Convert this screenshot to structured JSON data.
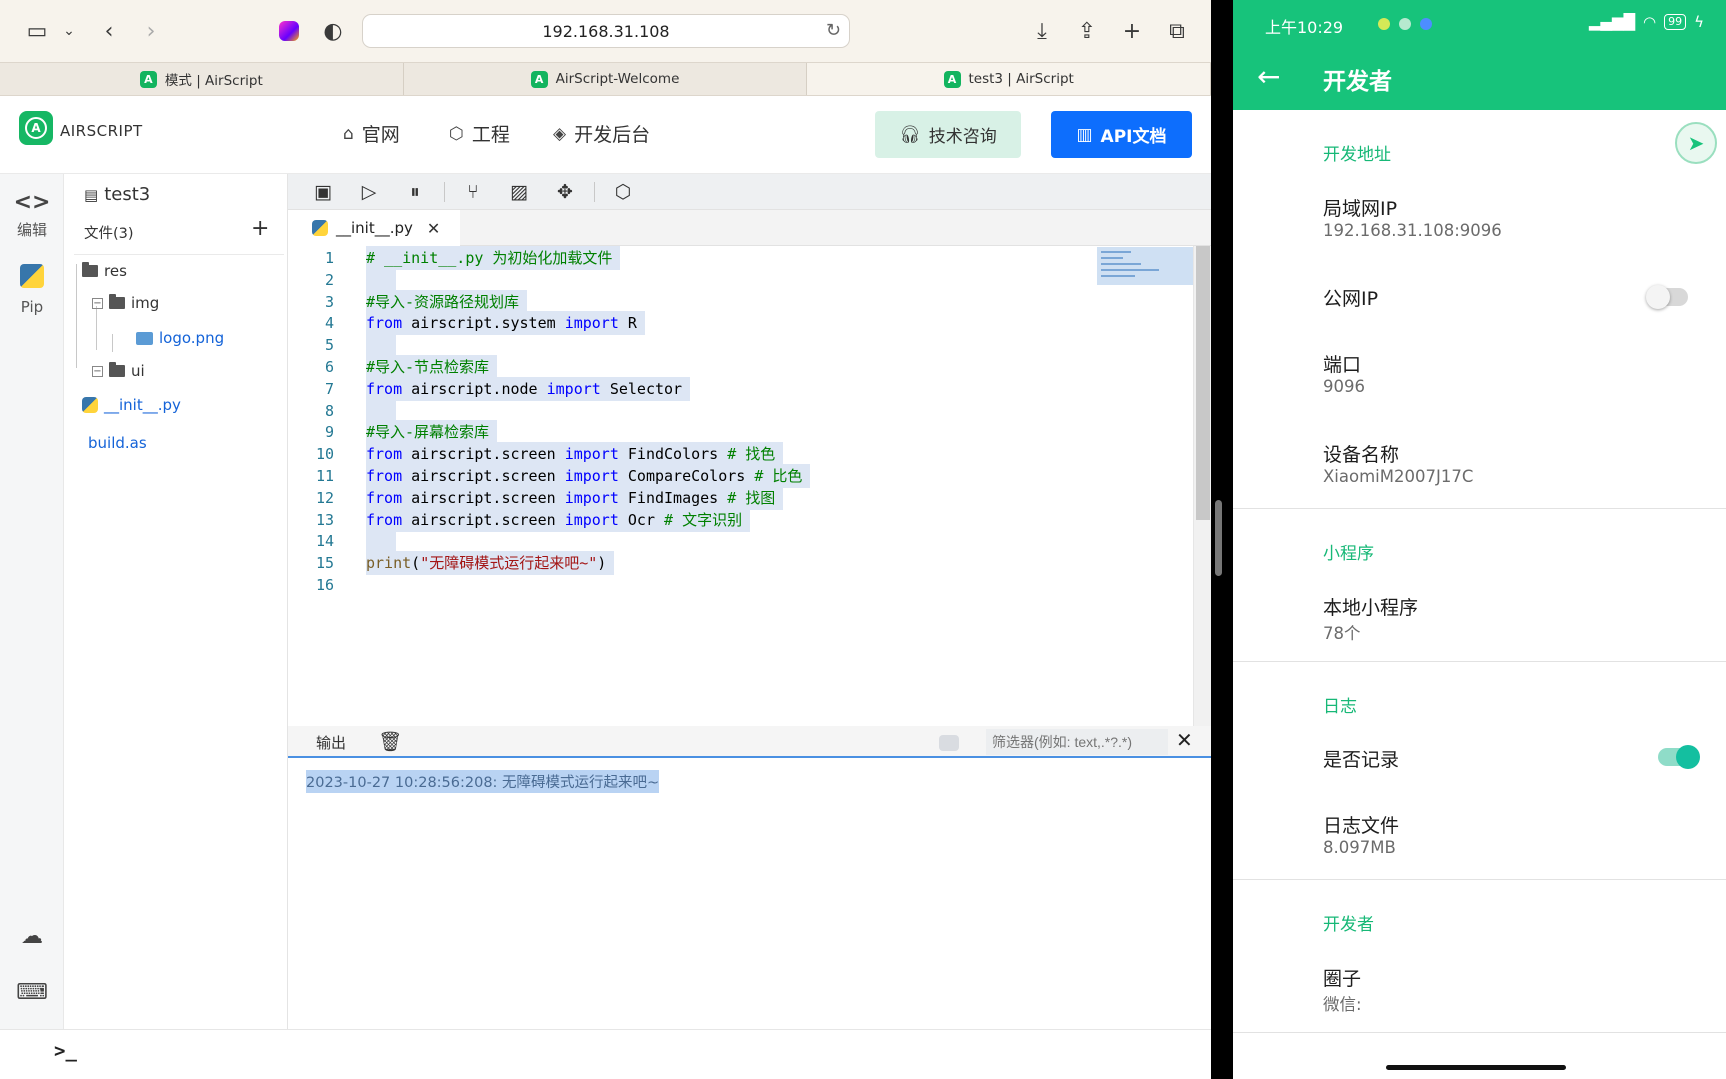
{
  "safari": {
    "url": "192.168.31.108",
    "tabs": [
      {
        "label": "模式 | AirScript"
      },
      {
        "label": "AirScript-Welcome"
      },
      {
        "label": "test3 | AirScript"
      }
    ]
  },
  "header": {
    "brand": "AIRSCRIPT",
    "nav": [
      "官网",
      "工程",
      "开发后台"
    ],
    "consult_label": "技术咨询",
    "api_label": "API文档"
  },
  "activity": {
    "edit_label": "编辑",
    "pip_label": "Pip"
  },
  "explorer": {
    "project": "test3",
    "files_label": "文件(3)",
    "tree": {
      "res": "res",
      "img": "img",
      "logo": "logo.png",
      "ui": "ui",
      "init": "__init__.py",
      "build": "build.as"
    }
  },
  "editor": {
    "tab_label": "__init__.py",
    "lines": [
      {
        "n": "1",
        "code": "# __init__.py 为初始化加载文件"
      },
      {
        "n": "2",
        "code": ""
      },
      {
        "n": "3",
        "code": "#导入-资源路径规划库"
      },
      {
        "n": "4",
        "code": "from airscript.system import R"
      },
      {
        "n": "5",
        "code": ""
      },
      {
        "n": "6",
        "code": "#导入-节点检索库"
      },
      {
        "n": "7",
        "code": "from airscript.node import Selector"
      },
      {
        "n": "8",
        "code": ""
      },
      {
        "n": "9",
        "code": "#导入-屏幕检索库"
      },
      {
        "n": "10",
        "code": "from airscript.screen import FindColors # 找色"
      },
      {
        "n": "11",
        "code": "from airscript.screen import CompareColors # 比色"
      },
      {
        "n": "12",
        "code": "from airscript.screen import FindImages # 找图"
      },
      {
        "n": "13",
        "code": "from airscript.screen import Ocr # 文字识别"
      },
      {
        "n": "14",
        "code": ""
      },
      {
        "n": "15",
        "code": "print(\"无障碍模式运行起来吧~\")"
      },
      {
        "n": "16",
        "code": ""
      }
    ]
  },
  "output": {
    "tab_label": "输出",
    "filter_placeholder": "筛选器(例如: text,.*?.*)",
    "log_line": "2023-10-27 10:28:56:208: 无障碍模式运行起来吧~"
  },
  "android": {
    "time": "上午10:29",
    "battery": "99",
    "title": "开发者",
    "sections": {
      "dev_addr": "开发地址",
      "mini": "小程序",
      "log": "日志",
      "dev": "开发者"
    },
    "items": {
      "lan_ip_title": "局域网IP",
      "lan_ip_value": "192.168.31.108:9096",
      "public_ip_title": "公网IP",
      "port_title": "端口",
      "port_value": "9096",
      "device_title": "设备名称",
      "device_value": "XiaomiM2007J17C",
      "local_mini_title": "本地小程序",
      "local_mini_value": "78个",
      "record_title": "是否记录",
      "logfile_title": "日志文件",
      "logfile_value": "8.097MB",
      "circle_title": "圈子",
      "circle_value": "微信:"
    },
    "toggles": {
      "public_ip": false,
      "record": true
    }
  },
  "colors": {
    "brand_green": "#17c37b",
    "api_blue": "#0d6efd",
    "consult_bg": "#d8f1e6"
  }
}
